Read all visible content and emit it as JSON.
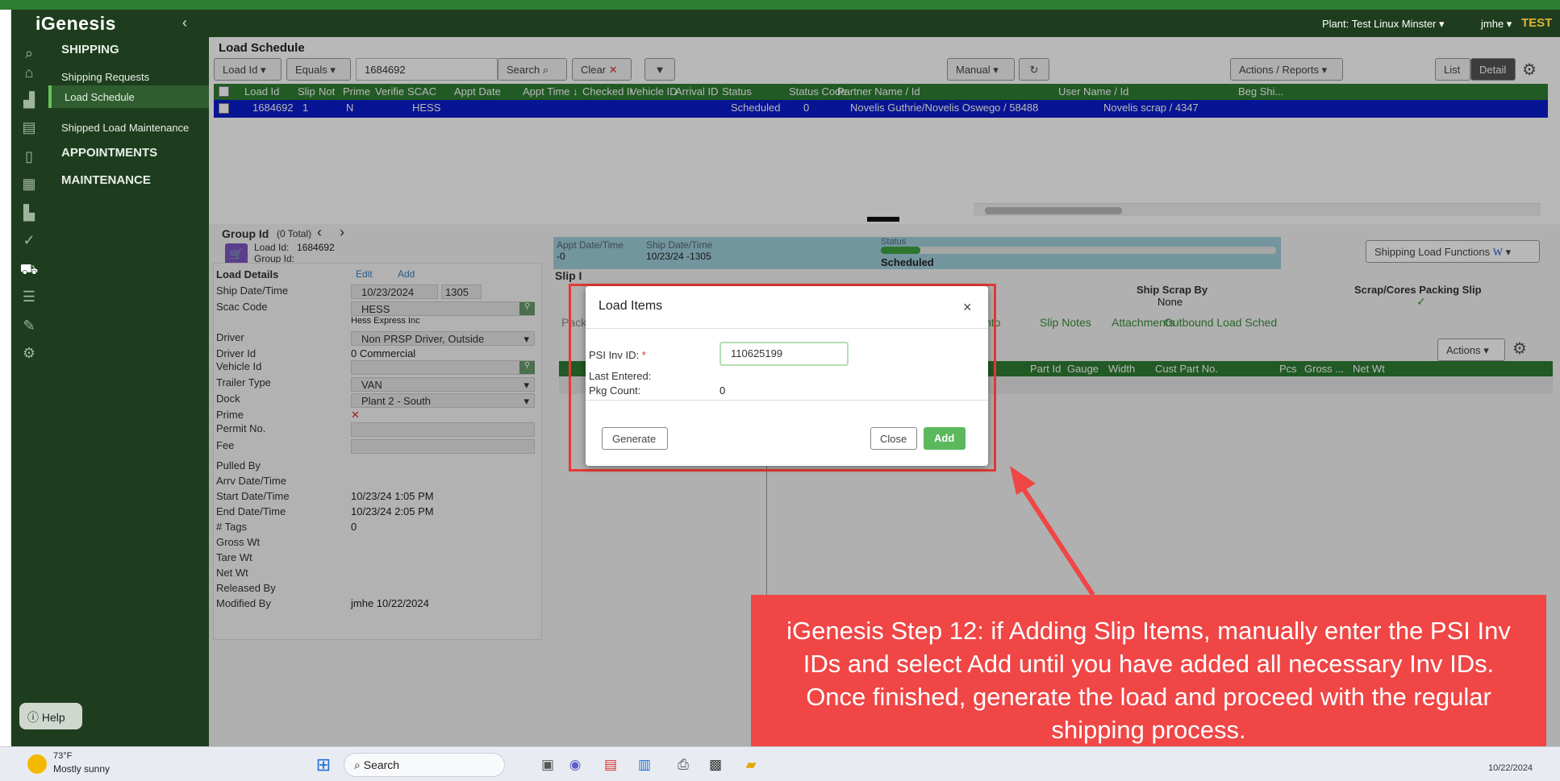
{
  "app": {
    "logo": "iGenesis",
    "plant": "Plant: Test Linux Minster ▾",
    "user": "jmhe ▾",
    "env": "TEST"
  },
  "nav": {
    "shipping": "SHIPPING",
    "shipping_requests": "Shipping Requests",
    "load_schedule": "Load Schedule",
    "shipped_load_maintenance": "Shipped Load Maintenance",
    "appointments": "APPOINTMENTS",
    "maintenance": "MAINTENANCE"
  },
  "page": {
    "title": "Load Schedule"
  },
  "toolbar": {
    "field_select": "Load Id",
    "op_select": "Equals",
    "search_value": "1684692",
    "search_label": "Search",
    "clear_label": "Clear",
    "mode_select": "Manual",
    "actions_reports": "Actions / Reports",
    "list_label": "List",
    "detail_label": "Detail"
  },
  "grid": {
    "columns": [
      "Load Id",
      "Slip",
      "Not",
      "Prime",
      "Verifie",
      "SCAC",
      "Appt Date",
      "Appt Time ↓",
      "Checked Ir",
      "Vehicle ID",
      "Arrival ID",
      "Status",
      "Status Code",
      "Partner Name / Id",
      "User Name / Id",
      "Beg Shi..."
    ],
    "row": {
      "load_id": "1684692",
      "slip": "1",
      "prime": "N",
      "scac": "HESS",
      "status": "Scheduled",
      "status_code": "0",
      "partner": "Novelis Guthrie/Novelis Oswego / 58488",
      "user": "Novelis scrap / 4347"
    }
  },
  "group": {
    "label": "Group Id",
    "total": "(0 Total)",
    "load_id_label": "Load Id:",
    "load_id": "1684692",
    "group_id_label": "Group Id:"
  },
  "status_bar": {
    "appt_label": "Appt Date/Time",
    "appt_value": "-0",
    "ship_label": "Ship Date/Time",
    "ship_value": "10/23/24 -1305",
    "status_label": "Status",
    "status_value": "Scheduled",
    "progress": 0.1
  },
  "shipping_functions": "Shipping Load Functions",
  "slip_tab_partial": "Slip I",
  "ship_scrap_by_label": "Ship Scrap By",
  "ship_scrap_by_value": "None",
  "packing_slip_label": "Scrap/Cores Packing Slip",
  "pack_partial": "Pack",
  "tabs": {
    "info_partial": "nto",
    "slip_notes": "Slip Notes",
    "attachments": "Attachments",
    "outbound": "Outbound Load Sched"
  },
  "items_actions": "Actions",
  "items_columns": [
    "Part Id",
    "Gauge",
    "Width",
    "Cust Part No.",
    "Pcs",
    "Gross ...",
    "Net Wt"
  ],
  "details": {
    "title": "Load Details",
    "edit": "Edit",
    "add": "Add",
    "ship_date_label": "Ship Date/Time",
    "ship_date": "10/23/2024",
    "ship_time": "1305",
    "scac_label": "Scac Code",
    "scac": "HESS",
    "scac_name": "Hess Express Inc",
    "driver_label": "Driver",
    "driver": "Non PRSP Driver, Outside",
    "driver_id_label": "Driver Id",
    "driver_id": "0 Commercial",
    "vehicle_label": "Vehicle Id",
    "trailer_label": "Trailer Type",
    "trailer": "VAN",
    "dock_label": "Dock",
    "dock": "Plant 2 - South",
    "prime_label": "Prime",
    "prime": "✕",
    "permit_label": "Permit No.",
    "fee_label": "Fee",
    "pulled_label": "Pulled By",
    "arrv_label": "Arrv Date/Time",
    "start_label": "Start Date/Time",
    "start": "10/23/24 1:05 PM",
    "end_label": "End Date/Time",
    "end": "10/23/24 2:05 PM",
    "tags_label": "# Tags",
    "tags": "0",
    "gross_label": "Gross Wt",
    "tare_label": "Tare Wt",
    "net_label": "Net Wt",
    "released_label": "Released By",
    "modified_label": "Modified By",
    "modified": "jmhe 10/22/2024"
  },
  "modal": {
    "title": "Load Items",
    "close_x": "×",
    "psi_label": "PSI Inv ID:",
    "required": "*",
    "psi_value": "110625199",
    "last_entered_label": "Last Entered:",
    "pkg_count_label": "Pkg Count:",
    "pkg_count": "0",
    "generate": "Generate",
    "close": "Close",
    "add": "Add"
  },
  "callout": "iGenesis Step 12: if Adding Slip Items, manually enter the PSI Inv IDs and select Add until you have added all necessary Inv IDs. Once finished, generate the load and proceed with the regular shipping process.",
  "help": "Help",
  "taskbar": {
    "temp": "73°F",
    "weather": "Mostly sunny",
    "search": "Search",
    "date": "10/22/2024"
  },
  "colors": {
    "accent_green": "#2e7d32",
    "selected_row": "#0b1dcc",
    "callout_red": "#f04646",
    "add_button": "#5cb85c"
  }
}
